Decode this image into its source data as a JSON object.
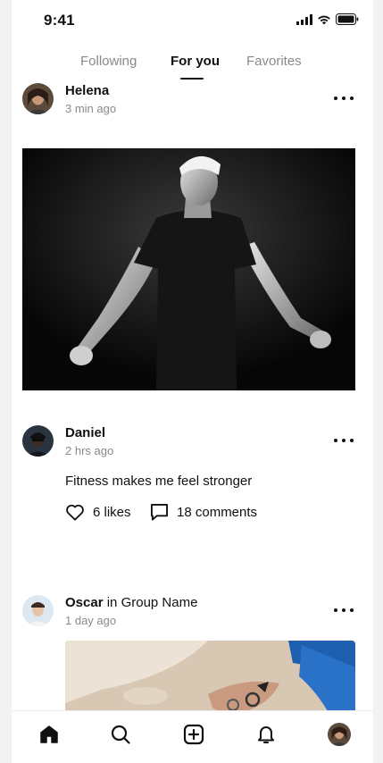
{
  "status_bar": {
    "time": "9:41"
  },
  "tabs": [
    {
      "label": "Following"
    },
    {
      "label": "For you"
    },
    {
      "label": "Favorites"
    }
  ],
  "posts": [
    {
      "username": "Helena",
      "time": "3 min ago"
    },
    {
      "username": "Daniel",
      "time": "2 hrs ago",
      "text": "Fitness makes me feel stronger",
      "likes": "6 likes",
      "comments": "18 comments"
    },
    {
      "username": "Oscar",
      "group_prefix": "in",
      "group_name": "Group Name",
      "time": "1 day ago"
    }
  ],
  "colors": {
    "text": "#111111",
    "muted": "#8a8a8a",
    "background": "#ffffff"
  },
  "nav": [
    "home-icon",
    "search-icon",
    "plus-square-icon",
    "bell-icon",
    "profile-avatar"
  ]
}
